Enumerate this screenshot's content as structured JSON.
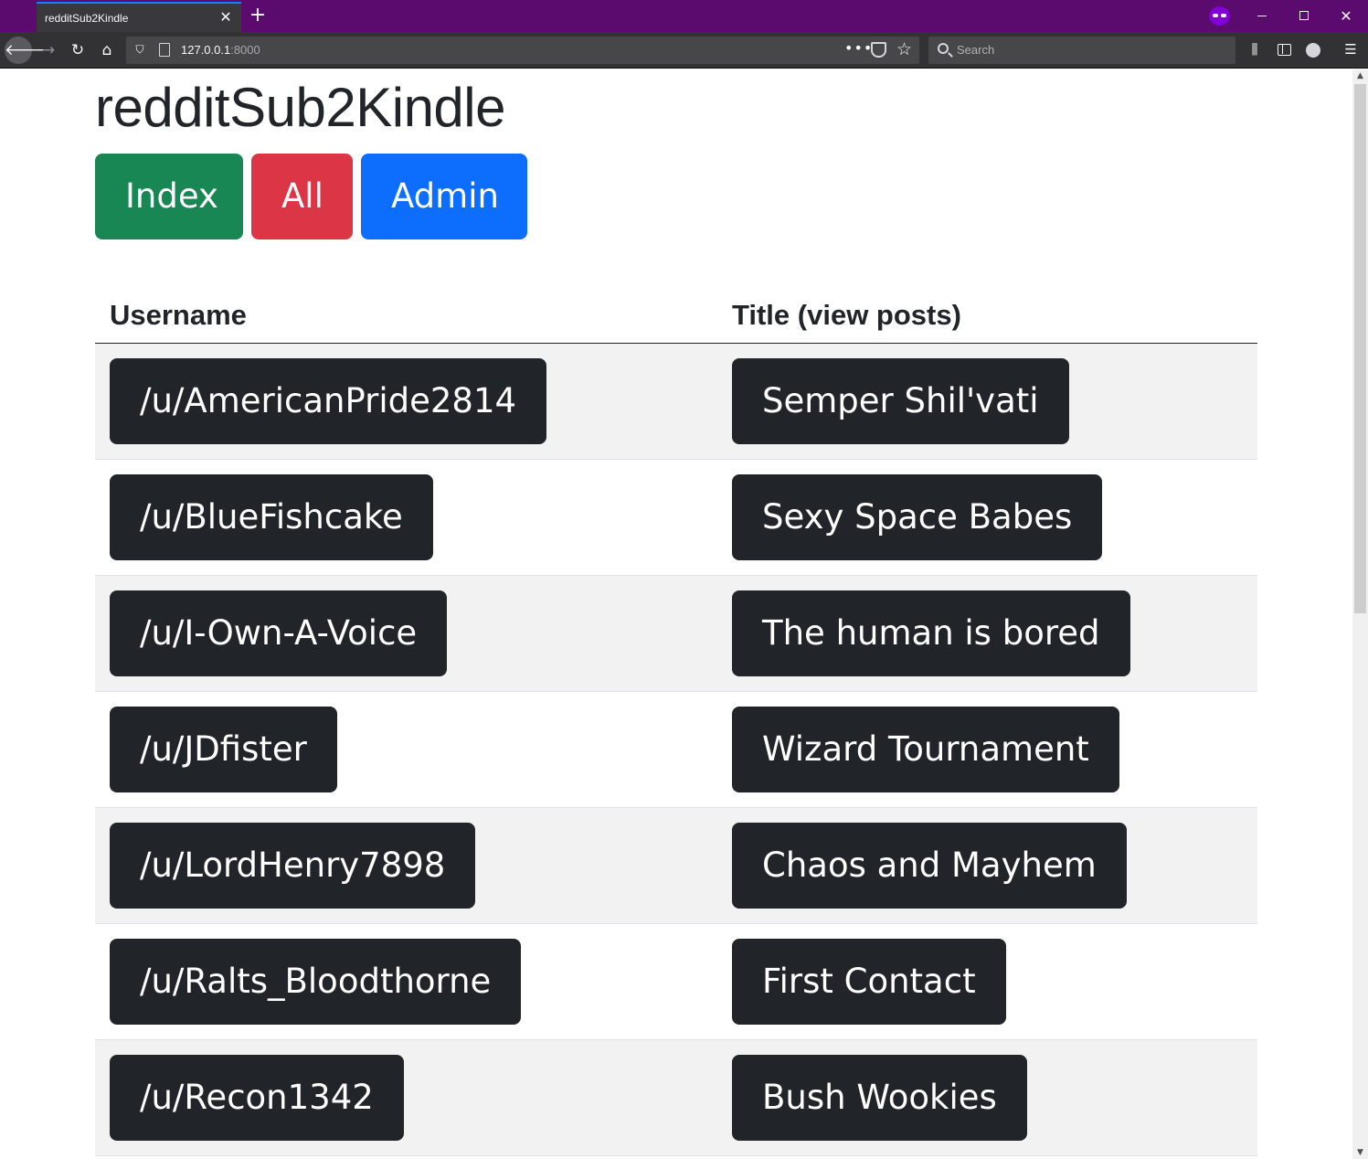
{
  "browser": {
    "tab_title": "redditSub2Kindle",
    "tab_close": "✕",
    "new_tab": "+",
    "url_host": "127.0.0.1",
    "url_port": ":8000",
    "search_placeholder": "Search",
    "private_mode_color": "#8000d7",
    "tabbar_color": "#5b0a6e"
  },
  "page": {
    "title": "redditSub2Kindle",
    "buttons": {
      "index": "Index",
      "all": "All",
      "admin": "Admin"
    },
    "table": {
      "headers": {
        "username": "Username",
        "title": "Title (view posts)"
      },
      "rows": [
        {
          "username": "/u/AmericanPride2814",
          "title": "Semper Shil'vati"
        },
        {
          "username": "/u/BlueFishcake",
          "title": "Sexy Space Babes"
        },
        {
          "username": "/u/I-Own-A-Voice",
          "title": "The human is bored"
        },
        {
          "username": "/u/JDfister",
          "title": "Wizard Tournament"
        },
        {
          "username": "/u/LordHenry7898",
          "title": "Chaos and Mayhem"
        },
        {
          "username": "/u/Ralts_Bloodthorne",
          "title": "First Contact"
        },
        {
          "username": "/u/Recon1342",
          "title": "Bush Wookies"
        }
      ]
    }
  },
  "colors": {
    "success": "#198754",
    "danger": "#dc3545",
    "primary": "#0d6efd",
    "dark": "#212529",
    "stripe": "#f2f2f2"
  }
}
